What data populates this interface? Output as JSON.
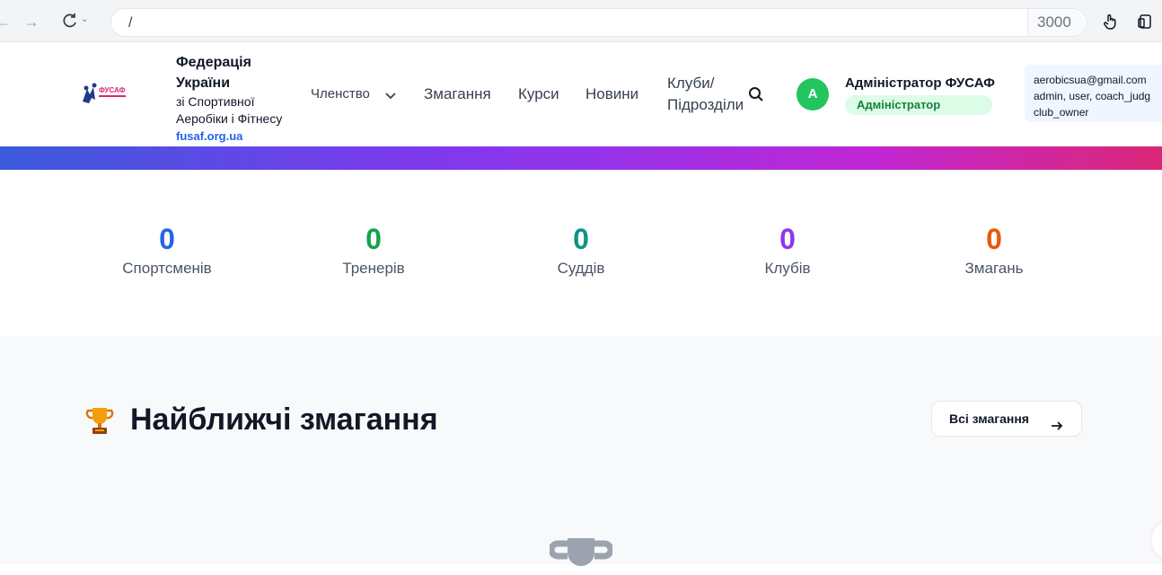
{
  "browser": {
    "url": "/",
    "port": "3000"
  },
  "header": {
    "brand_line1": "Федерація",
    "brand_line2": "України",
    "brand_line3": "зі Спортивної",
    "brand_line4": "Аеробіки і Фітнесу",
    "brand_url": "fusaf.org.ua",
    "nav": {
      "membership": "Членство",
      "competitions": "Змагання",
      "courses": "Курси",
      "news": "Новини",
      "clubs_line1": "Клуби/",
      "clubs_line2": "Підрозділи"
    },
    "user": {
      "avatar_initial": "A",
      "name": "Адміністратор ФУСАФ",
      "role": "Адміністратор"
    },
    "debug": {
      "email": "aerobicsua@gmail.com",
      "roles_line1": "admin, user, coach_judg",
      "roles_line2": "club_owner"
    }
  },
  "stats": [
    {
      "value": "0",
      "label": "Спортсменів",
      "color": "#2563eb"
    },
    {
      "value": "0",
      "label": "Тренерів",
      "color": "#16a34a"
    },
    {
      "value": "0",
      "label": "Суддів",
      "color": "#0d9488"
    },
    {
      "value": "0",
      "label": "Клубів",
      "color": "#9333ea"
    },
    {
      "value": "0",
      "label": "Змагань",
      "color": "#ea580c"
    }
  ],
  "upcoming": {
    "title": "Найближчі змагання",
    "all_button": "Всі змагання"
  },
  "icons": [
    "back-icon",
    "forward-icon",
    "reload-icon",
    "hand-icon",
    "device-icon",
    "chevron-down-icon",
    "search-icon",
    "trophy-icon",
    "arrow-right-icon"
  ]
}
